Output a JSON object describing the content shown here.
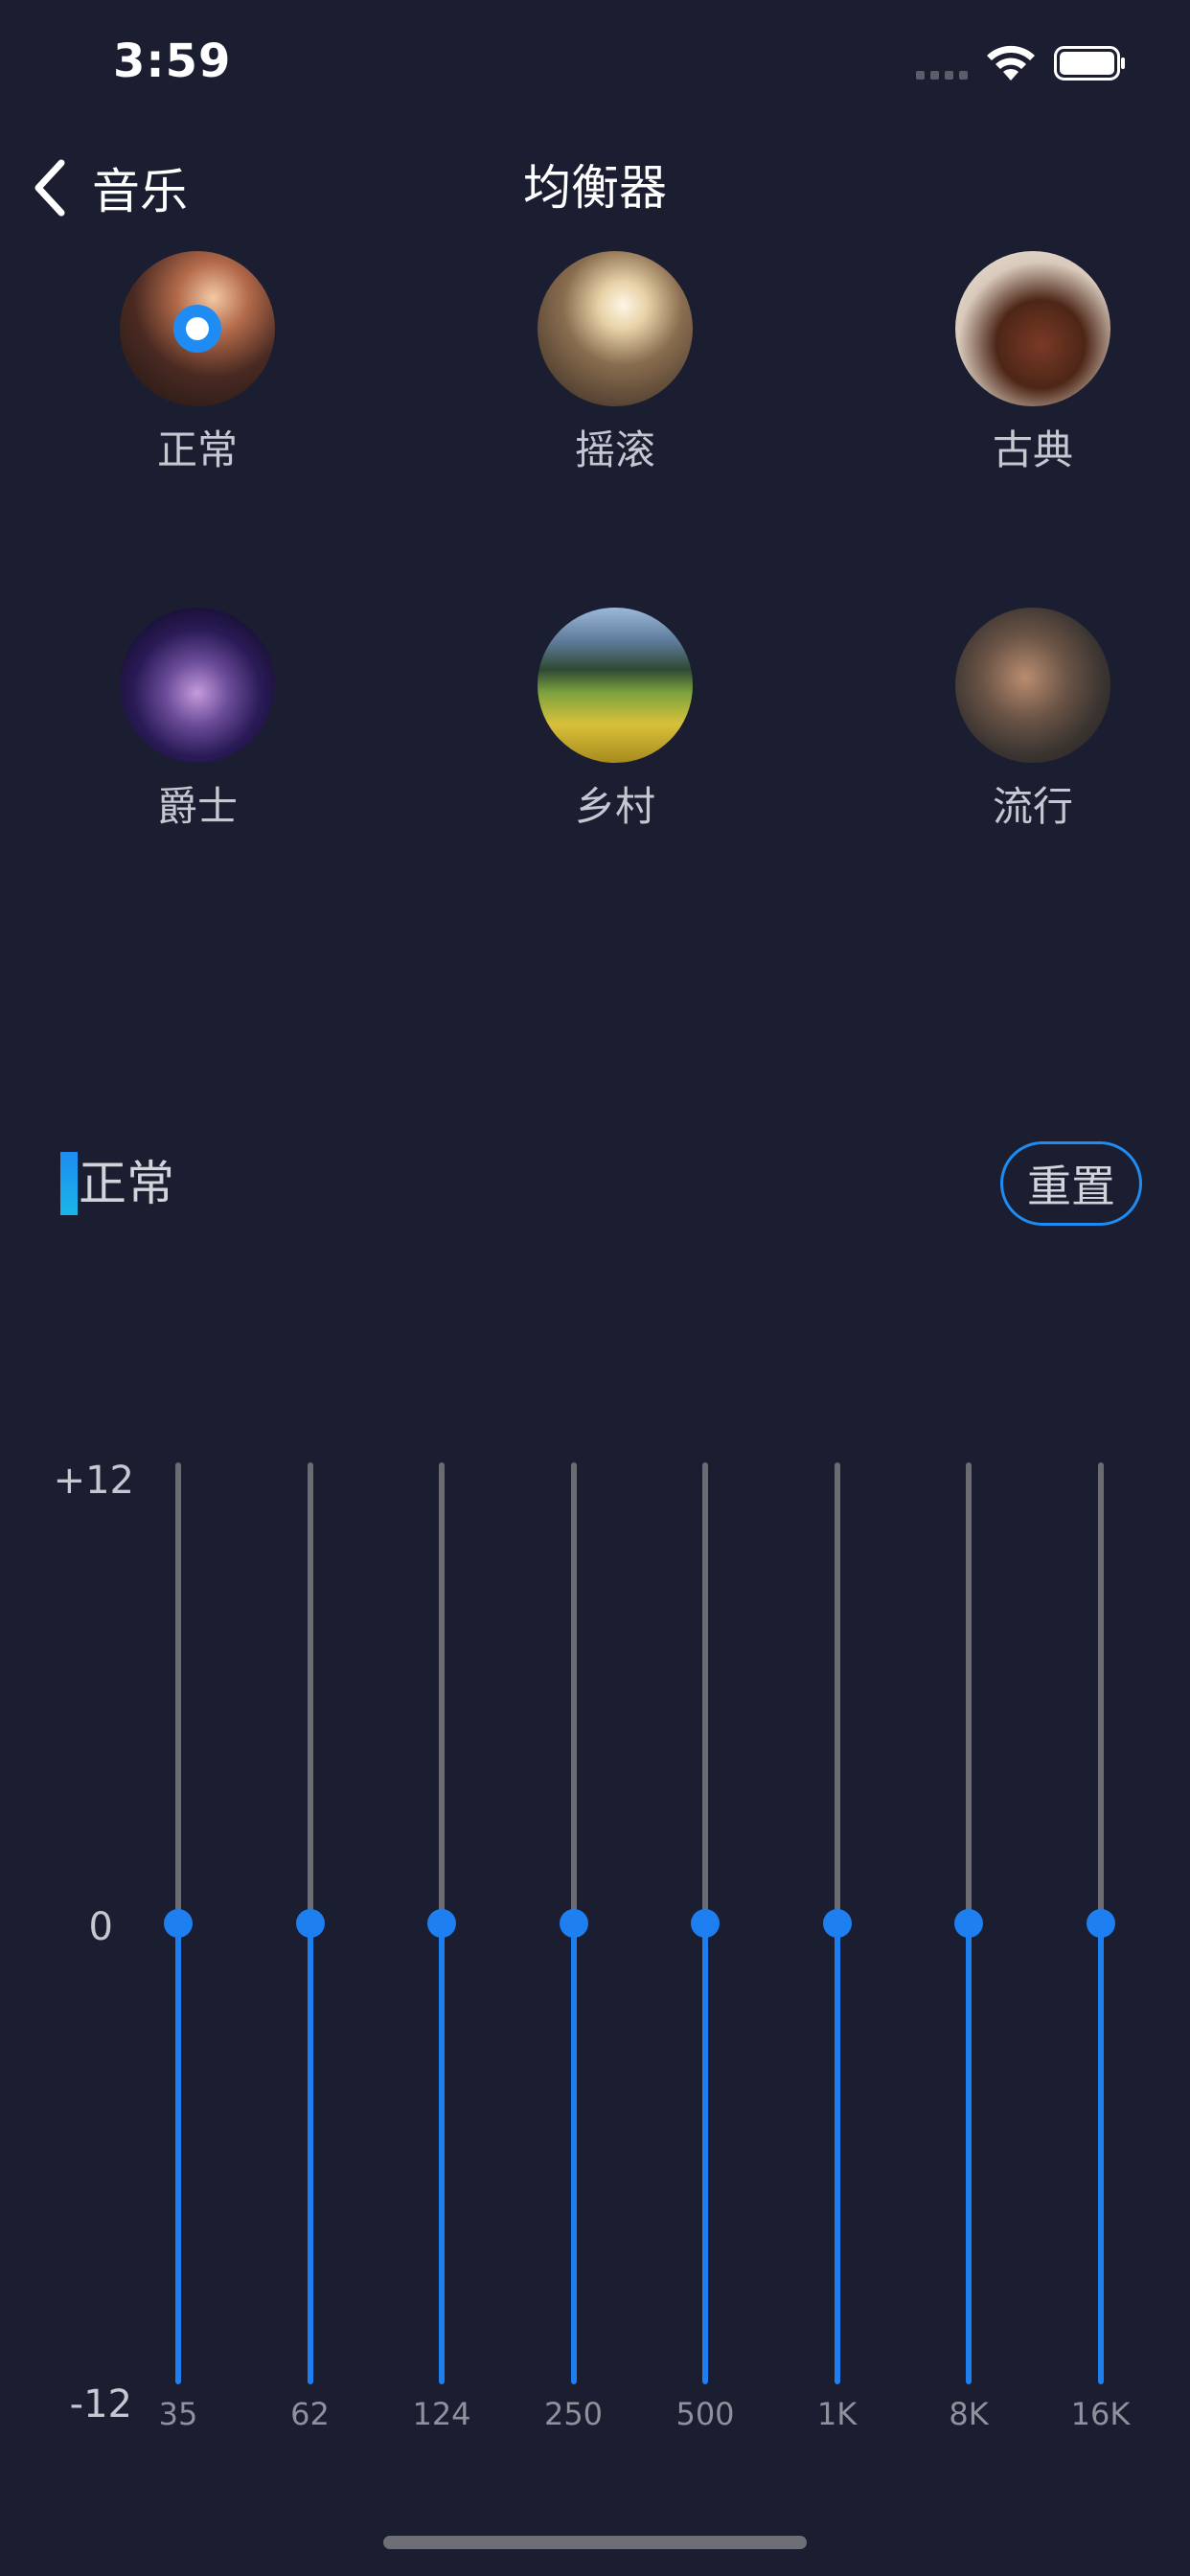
{
  "status_bar": {
    "time": "3:59",
    "wifi_icon": "wifi-icon",
    "battery_icon": "battery-icon"
  },
  "nav": {
    "back_label": "音乐",
    "title": "均衡器",
    "back_icon": "chevron-left-icon"
  },
  "presets": [
    {
      "label": "正常",
      "selected": true
    },
    {
      "label": "摇滚",
      "selected": false
    },
    {
      "label": "古典",
      "selected": false
    },
    {
      "label": "爵士",
      "selected": false
    },
    {
      "label": "乡村",
      "selected": false
    },
    {
      "label": "流行",
      "selected": false
    }
  ],
  "current_preset": {
    "label": "正常",
    "reset_label": "重置"
  },
  "equalizer": {
    "axis_top": "+12",
    "axis_mid": "0",
    "axis_bottom": "-12",
    "min_db": -12,
    "max_db": 12,
    "bands": [
      {
        "freq": "35",
        "gain_db": 0
      },
      {
        "freq": "62",
        "gain_db": 0
      },
      {
        "freq": "124",
        "gain_db": 0
      },
      {
        "freq": "250",
        "gain_db": 0
      },
      {
        "freq": "500",
        "gain_db": 0
      },
      {
        "freq": "1K",
        "gain_db": 0
      },
      {
        "freq": "8K",
        "gain_db": 0
      },
      {
        "freq": "16K",
        "gain_db": 0
      }
    ]
  },
  "colors": {
    "background": "#1b1e30",
    "accent": "#1e7ff0",
    "track": "#6a6b73"
  }
}
